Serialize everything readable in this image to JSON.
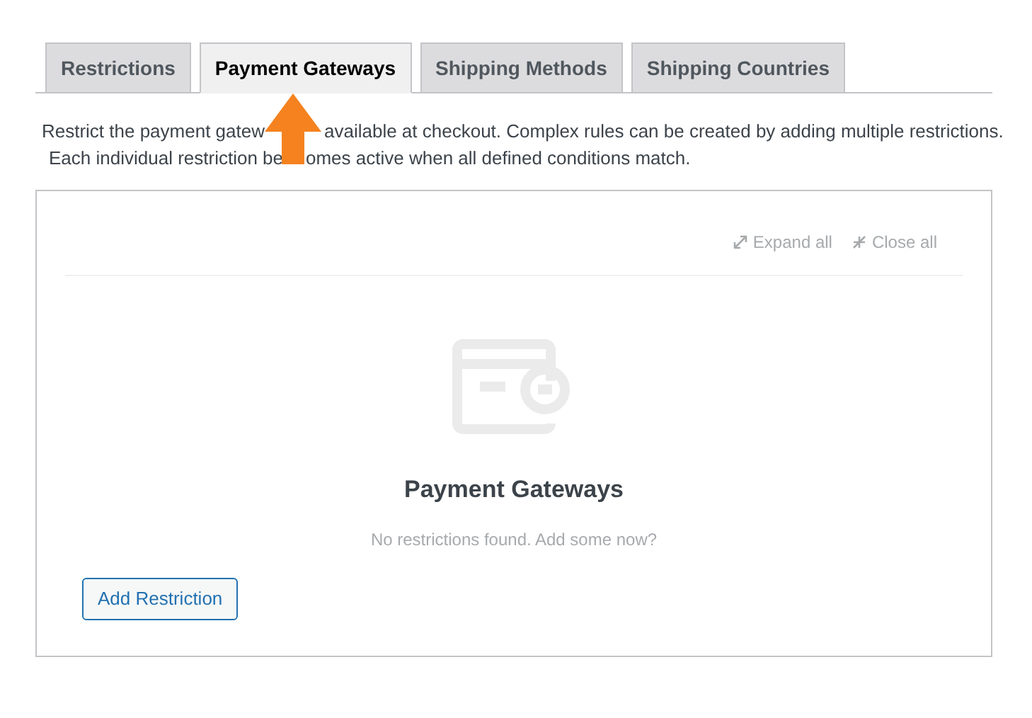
{
  "tabs": [
    {
      "label": "Restrictions",
      "selected": false
    },
    {
      "label": "Payment Gateways",
      "selected": true
    },
    {
      "label": "Shipping Methods",
      "selected": false
    },
    {
      "label": "Shipping Countries",
      "selected": false
    }
  ],
  "description": [
    [
      "Restrict the payment gatew",
      "available at checkout. Complex rules can be created by adding multiple restrictions."
    ],
    [
      "Each individual restriction be",
      "omes active when all defined conditions match."
    ]
  ],
  "toolbar": {
    "expand": "Expand all",
    "close": "Close all"
  },
  "empty_state": {
    "title": "Payment Gateways",
    "message": "No restrictions found. Add some now?"
  },
  "add_button": "Add Restriction"
}
